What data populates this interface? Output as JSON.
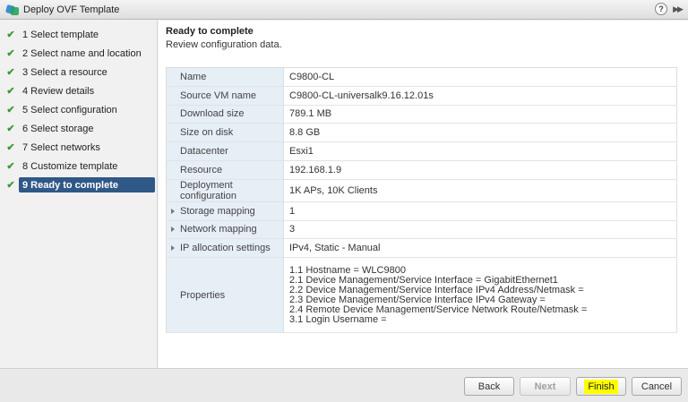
{
  "window": {
    "title": "Deploy OVF Template",
    "help_glyph": "?",
    "collapse_glyph": "▶▶"
  },
  "steps": [
    {
      "label": "1  Select template",
      "done": true
    },
    {
      "label": "2  Select name and location",
      "done": true
    },
    {
      "label": "3  Select a resource",
      "done": true
    },
    {
      "label": "4  Review details",
      "done": true
    },
    {
      "label": "5  Select configuration",
      "done": true
    },
    {
      "label": "6  Select storage",
      "done": true
    },
    {
      "label": "7  Select networks",
      "done": true
    },
    {
      "label": "8  Customize template",
      "done": true
    },
    {
      "label": "9  Ready to complete",
      "done": true,
      "active": true
    }
  ],
  "main": {
    "title": "Ready to complete",
    "subtitle": "Review configuration data."
  },
  "rows": [
    {
      "key": "Name",
      "value": "C9800-CL"
    },
    {
      "key": "Source VM name",
      "value": "C9800-CL-universalk9.16.12.01s"
    },
    {
      "key": "Download size",
      "value": "789.1 MB"
    },
    {
      "key": "Size on disk",
      "value": "8.8 GB"
    },
    {
      "key": "Datacenter",
      "value": "Esxi1"
    },
    {
      "key": "Resource",
      "value": "192.168.1.9"
    },
    {
      "key": "Deployment configuration",
      "value": "1K APs, 10K Clients"
    },
    {
      "key": "Storage mapping",
      "value": "1",
      "expandable": true
    },
    {
      "key": "Network mapping",
      "value": "3",
      "expandable": true
    },
    {
      "key": "IP allocation settings",
      "value": "IPv4, Static - Manual",
      "expandable": true
    }
  ],
  "properties": {
    "key": "Properties",
    "lines": [
      "1.1 Hostname = WLC9800",
      "2.1 Device Management/Service Interface = GigabitEthernet1",
      "2.2 Device Management/Service Interface IPv4 Address/Netmask =",
      "2.3 Device Management/Service Interface IPv4 Gateway =",
      "2.4 Remote Device Management/Service  Network Route/Netmask =",
      "3.1 Login Username ="
    ]
  },
  "footer": {
    "back_label": "Back",
    "next_label": "Next",
    "finish_label": "Finish",
    "cancel_label": "Cancel"
  },
  "colors": {
    "active_step": "#2f5887",
    "check": "#3a9a3a",
    "key_bg": "#e6eef6",
    "finish_highlight": "#ffff00"
  }
}
